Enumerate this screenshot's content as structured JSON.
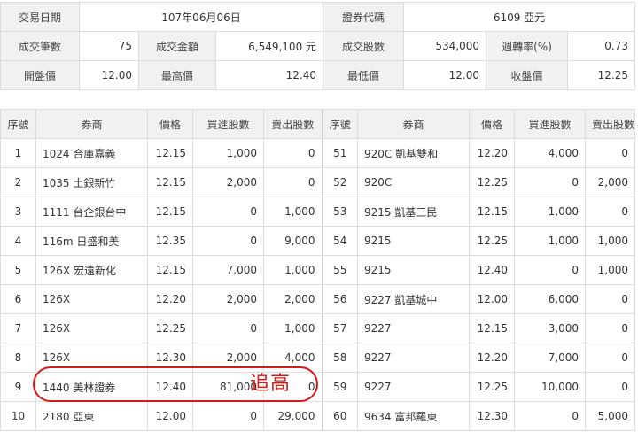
{
  "summary": {
    "row1": {
      "trade_date_label": "交易日期",
      "trade_date_value": "107年06月06日",
      "stock_code_label": "證券代碼",
      "stock_code_value": "6109 亞元"
    },
    "row2": {
      "deals_label": "成交筆數",
      "deals_value": "75",
      "amount_label": "成交金額",
      "amount_value": "6,549,100 元",
      "shares_label": "成交股數",
      "shares_value": "534,000",
      "turnover_label": "週轉率(%)",
      "turnover_value": "0.73"
    },
    "row3": {
      "open_label": "開盤價",
      "open_value": "12.00",
      "high_label": "最高價",
      "high_value": "12.40",
      "low_label": "最低價",
      "low_value": "12.00",
      "close_label": "收盤價",
      "close_value": "12.25"
    }
  },
  "trades": {
    "headers": [
      "序號",
      "券商",
      "價格",
      "買進股數",
      "賣出股數",
      "序號",
      "券商",
      "價格",
      "買進股數",
      "賣出股數"
    ],
    "rows": [
      [
        [
          "1",
          "1024 合庫嘉義",
          "12.15",
          "1,000",
          "0"
        ],
        [
          "51",
          "920C 凱基雙和",
          "12.20",
          "4,000",
          "0"
        ]
      ],
      [
        [
          "2",
          "1035 土銀新竹",
          "12.15",
          "2,000",
          "0"
        ],
        [
          "52",
          "920C",
          "12.25",
          "0",
          "2,000"
        ]
      ],
      [
        [
          "3",
          "1111 台企銀台中",
          "12.15",
          "0",
          "1,000"
        ],
        [
          "53",
          "9215 凱基三民",
          "12.15",
          "1,000",
          "0"
        ]
      ],
      [
        [
          "4",
          "116m 日盛和美",
          "12.35",
          "0",
          "9,000"
        ],
        [
          "54",
          "9215",
          "12.25",
          "1,000",
          "1,000"
        ]
      ],
      [
        [
          "5",
          "126X 宏遠新化",
          "12.15",
          "7,000",
          "1,000"
        ],
        [
          "55",
          "9215",
          "12.40",
          "0",
          "1,000"
        ]
      ],
      [
        [
          "6",
          "126X",
          "12.20",
          "2,000",
          "2,000"
        ],
        [
          "56",
          "9227 凱基城中",
          "12.00",
          "6,000",
          "0"
        ]
      ],
      [
        [
          "7",
          "126X",
          "12.25",
          "0",
          "1,000"
        ],
        [
          "57",
          "9227",
          "12.15",
          "3,000",
          "0"
        ]
      ],
      [
        [
          "8",
          "126X",
          "12.30",
          "2,000",
          "4,000"
        ],
        [
          "58",
          "9227",
          "12.20",
          "7,000",
          "0"
        ]
      ],
      [
        [
          "9",
          "1440 美林證券",
          "12.40",
          "81,000",
          "0"
        ],
        [
          "59",
          "9227",
          "12.25",
          "10,000",
          "0"
        ]
      ],
      [
        [
          "10",
          "2180 亞東",
          "12.00",
          "0",
          "29,000"
        ],
        [
          "60",
          "9634 富邦羅東",
          "12.30",
          "0",
          "5,000"
        ]
      ]
    ]
  },
  "annotation": {
    "text": "追高",
    "color": "#d71818"
  }
}
